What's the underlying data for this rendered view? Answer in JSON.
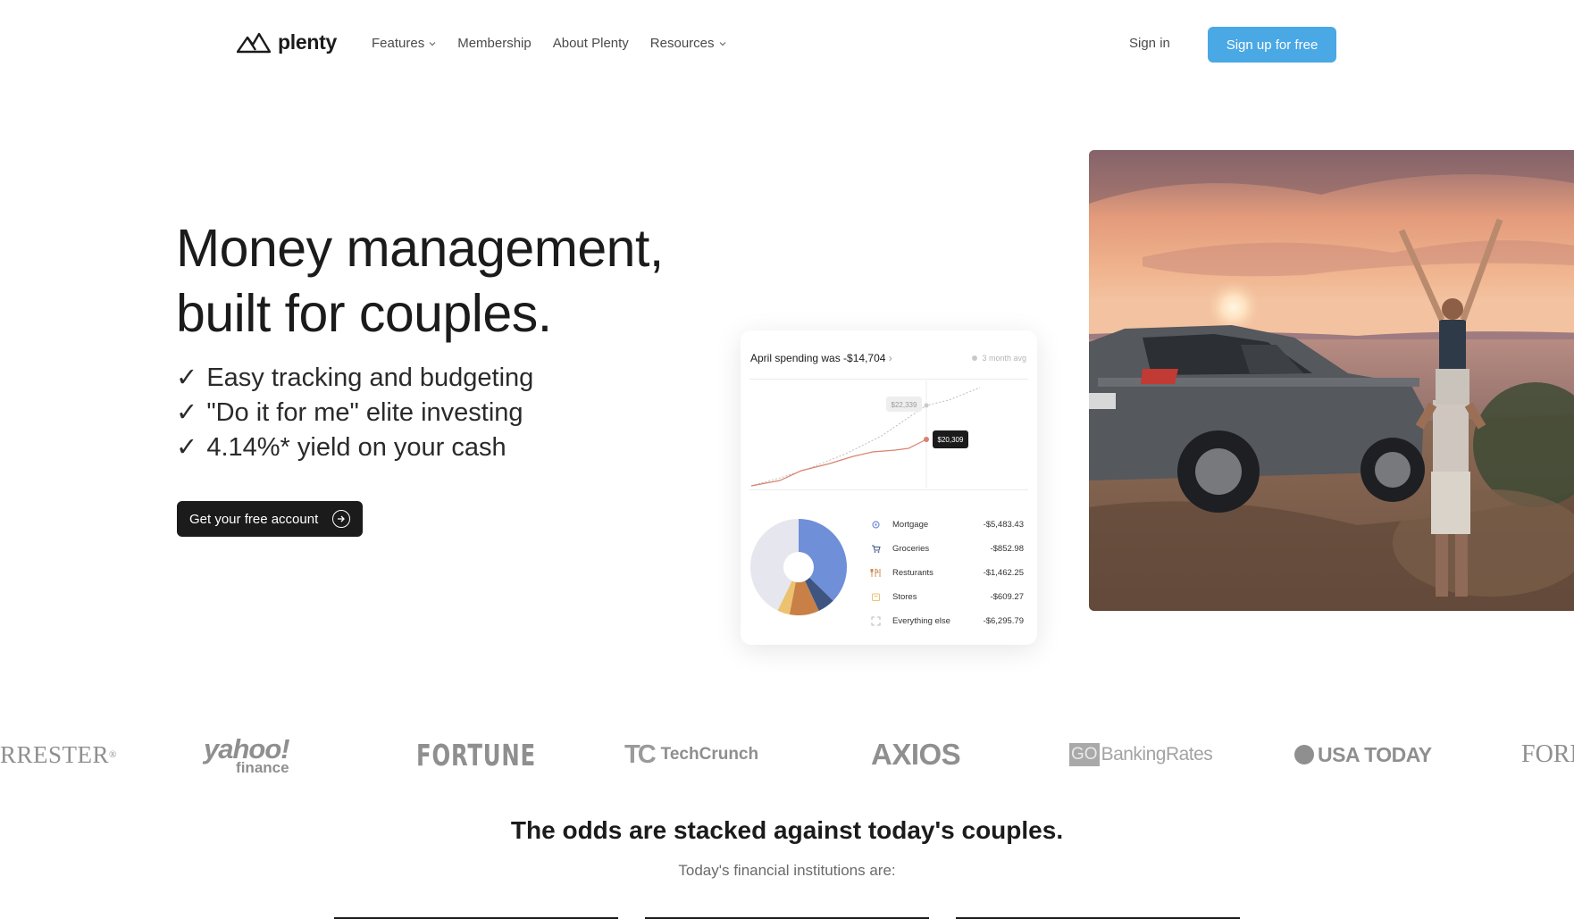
{
  "nav": {
    "brand": "plenty",
    "links": [
      {
        "label": "Features",
        "has_dropdown": true
      },
      {
        "label": "Membership",
        "has_dropdown": false
      },
      {
        "label": "About Plenty",
        "has_dropdown": false
      },
      {
        "label": "Resources",
        "has_dropdown": true
      }
    ],
    "signin_label": "Sign in",
    "signup_label": "Sign up for free"
  },
  "hero": {
    "title_line1": "Money management,",
    "title_line2": "built for couples.",
    "bullets": [
      {
        "check": "✓",
        "text": "Easy tracking and budgeting"
      },
      {
        "check": "✓",
        "text": "\"Do it for me\" elite investing"
      },
      {
        "check": "✓",
        "text": "4.14%* yield on your cash"
      }
    ],
    "cta_label": "Get your free account"
  },
  "card": {
    "heading": "April spending was -$14,704",
    "heading_chevron": "›",
    "avg_label": "3 month avg",
    "callout_avg": "$22,339",
    "callout_current": "$20,309",
    "categories": [
      {
        "name": "Mortgage",
        "amount": "-$5,483.43",
        "icon": "mortgage-icon",
        "color": "#6f8fd8"
      },
      {
        "name": "Groceries",
        "amount": "-$852.98",
        "icon": "cart-icon",
        "color": "#3d5580"
      },
      {
        "name": "Resturants",
        "amount": "-$1,462.25",
        "icon": "restaurant-icon",
        "color": "#c88047"
      },
      {
        "name": "Stores",
        "amount": "-$609.27",
        "icon": "store-icon",
        "color": "#ecc270"
      },
      {
        "name": "Everything else",
        "amount": "-$6,295.79",
        "icon": "expand-icon",
        "color": "#e6e7ee"
      }
    ]
  },
  "press": [
    {
      "name": "RRESTER",
      "suffix": "®"
    },
    {
      "name": "yahoo!",
      "sub": "finance"
    },
    {
      "name": "FORTUNE"
    },
    {
      "name": "TechCrunch",
      "mark": "TC"
    },
    {
      "name": "AXIOS"
    },
    {
      "name": "BankingRates",
      "mark": "GO"
    },
    {
      "name": "USA TODAY"
    },
    {
      "name": "FORB"
    }
  ],
  "odds": {
    "title": "The odds are stacked against today's couples.",
    "subtitle": "Today's financial institutions are:"
  },
  "colors": {
    "accent": "#4aa8e4",
    "dark": "#1b1b1b",
    "line_actual": "#d9826f",
    "line_avg": "#b9b9b9"
  }
}
